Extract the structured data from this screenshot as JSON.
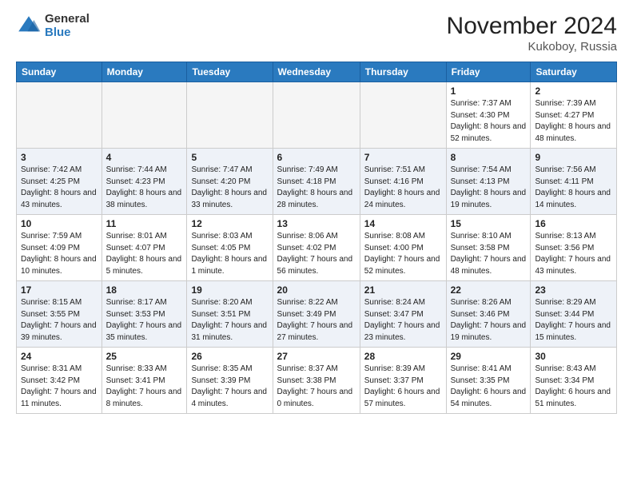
{
  "header": {
    "logo_general": "General",
    "logo_blue": "Blue",
    "month_title": "November 2024",
    "location": "Kukoboy, Russia"
  },
  "weekdays": [
    "Sunday",
    "Monday",
    "Tuesday",
    "Wednesday",
    "Thursday",
    "Friday",
    "Saturday"
  ],
  "weeks": [
    [
      {
        "day": "",
        "info": ""
      },
      {
        "day": "",
        "info": ""
      },
      {
        "day": "",
        "info": ""
      },
      {
        "day": "",
        "info": ""
      },
      {
        "day": "",
        "info": ""
      },
      {
        "day": "1",
        "info": "Sunrise: 7:37 AM\nSunset: 4:30 PM\nDaylight: 8 hours and 52 minutes."
      },
      {
        "day": "2",
        "info": "Sunrise: 7:39 AM\nSunset: 4:27 PM\nDaylight: 8 hours and 48 minutes."
      }
    ],
    [
      {
        "day": "3",
        "info": "Sunrise: 7:42 AM\nSunset: 4:25 PM\nDaylight: 8 hours and 43 minutes."
      },
      {
        "day": "4",
        "info": "Sunrise: 7:44 AM\nSunset: 4:23 PM\nDaylight: 8 hours and 38 minutes."
      },
      {
        "day": "5",
        "info": "Sunrise: 7:47 AM\nSunset: 4:20 PM\nDaylight: 8 hours and 33 minutes."
      },
      {
        "day": "6",
        "info": "Sunrise: 7:49 AM\nSunset: 4:18 PM\nDaylight: 8 hours and 28 minutes."
      },
      {
        "day": "7",
        "info": "Sunrise: 7:51 AM\nSunset: 4:16 PM\nDaylight: 8 hours and 24 minutes."
      },
      {
        "day": "8",
        "info": "Sunrise: 7:54 AM\nSunset: 4:13 PM\nDaylight: 8 hours and 19 minutes."
      },
      {
        "day": "9",
        "info": "Sunrise: 7:56 AM\nSunset: 4:11 PM\nDaylight: 8 hours and 14 minutes."
      }
    ],
    [
      {
        "day": "10",
        "info": "Sunrise: 7:59 AM\nSunset: 4:09 PM\nDaylight: 8 hours and 10 minutes."
      },
      {
        "day": "11",
        "info": "Sunrise: 8:01 AM\nSunset: 4:07 PM\nDaylight: 8 hours and 5 minutes."
      },
      {
        "day": "12",
        "info": "Sunrise: 8:03 AM\nSunset: 4:05 PM\nDaylight: 8 hours and 1 minute."
      },
      {
        "day": "13",
        "info": "Sunrise: 8:06 AM\nSunset: 4:02 PM\nDaylight: 7 hours and 56 minutes."
      },
      {
        "day": "14",
        "info": "Sunrise: 8:08 AM\nSunset: 4:00 PM\nDaylight: 7 hours and 52 minutes."
      },
      {
        "day": "15",
        "info": "Sunrise: 8:10 AM\nSunset: 3:58 PM\nDaylight: 7 hours and 48 minutes."
      },
      {
        "day": "16",
        "info": "Sunrise: 8:13 AM\nSunset: 3:56 PM\nDaylight: 7 hours and 43 minutes."
      }
    ],
    [
      {
        "day": "17",
        "info": "Sunrise: 8:15 AM\nSunset: 3:55 PM\nDaylight: 7 hours and 39 minutes."
      },
      {
        "day": "18",
        "info": "Sunrise: 8:17 AM\nSunset: 3:53 PM\nDaylight: 7 hours and 35 minutes."
      },
      {
        "day": "19",
        "info": "Sunrise: 8:20 AM\nSunset: 3:51 PM\nDaylight: 7 hours and 31 minutes."
      },
      {
        "day": "20",
        "info": "Sunrise: 8:22 AM\nSunset: 3:49 PM\nDaylight: 7 hours and 27 minutes."
      },
      {
        "day": "21",
        "info": "Sunrise: 8:24 AM\nSunset: 3:47 PM\nDaylight: 7 hours and 23 minutes."
      },
      {
        "day": "22",
        "info": "Sunrise: 8:26 AM\nSunset: 3:46 PM\nDaylight: 7 hours and 19 minutes."
      },
      {
        "day": "23",
        "info": "Sunrise: 8:29 AM\nSunset: 3:44 PM\nDaylight: 7 hours and 15 minutes."
      }
    ],
    [
      {
        "day": "24",
        "info": "Sunrise: 8:31 AM\nSunset: 3:42 PM\nDaylight: 7 hours and 11 minutes."
      },
      {
        "day": "25",
        "info": "Sunrise: 8:33 AM\nSunset: 3:41 PM\nDaylight: 7 hours and 8 minutes."
      },
      {
        "day": "26",
        "info": "Sunrise: 8:35 AM\nSunset: 3:39 PM\nDaylight: 7 hours and 4 minutes."
      },
      {
        "day": "27",
        "info": "Sunrise: 8:37 AM\nSunset: 3:38 PM\nDaylight: 7 hours and 0 minutes."
      },
      {
        "day": "28",
        "info": "Sunrise: 8:39 AM\nSunset: 3:37 PM\nDaylight: 6 hours and 57 minutes."
      },
      {
        "day": "29",
        "info": "Sunrise: 8:41 AM\nSunset: 3:35 PM\nDaylight: 6 hours and 54 minutes."
      },
      {
        "day": "30",
        "info": "Sunrise: 8:43 AM\nSunset: 3:34 PM\nDaylight: 6 hours and 51 minutes."
      }
    ]
  ]
}
